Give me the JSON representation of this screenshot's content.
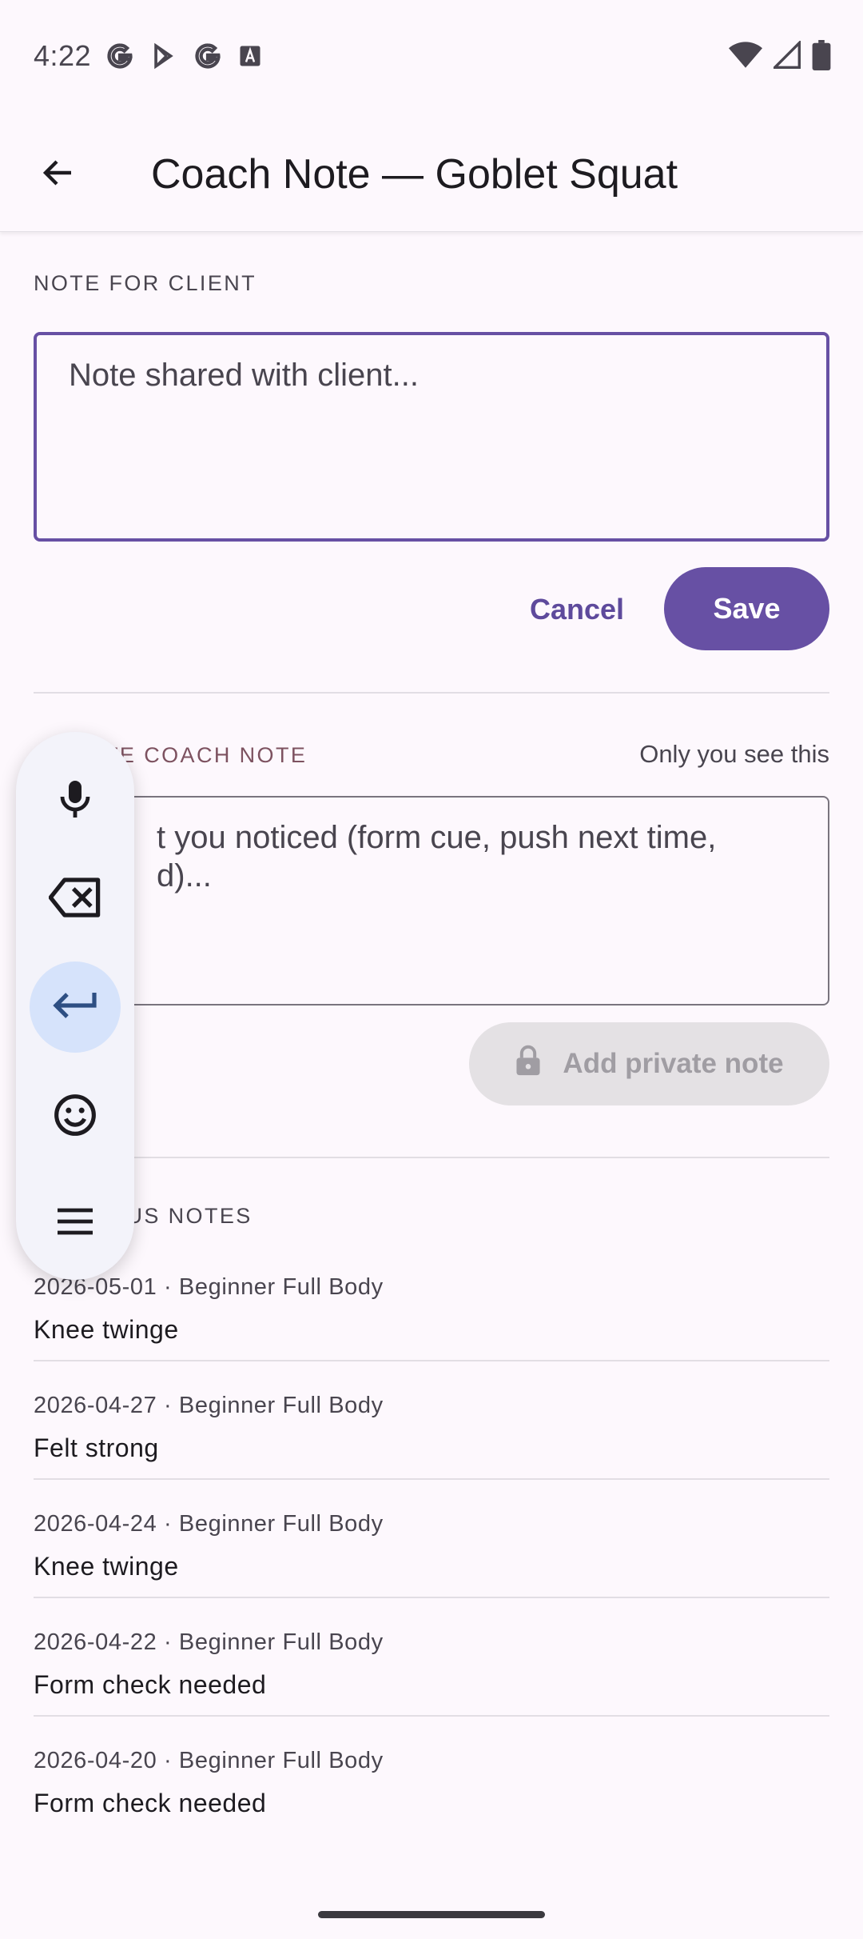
{
  "status_bar": {
    "time": "4:22",
    "left_icons": [
      "google-g-icon",
      "play-store-icon",
      "google-g-icon",
      "font-a-icon"
    ],
    "right_icons": [
      "wifi-icon",
      "cell-signal-icon",
      "battery-icon"
    ]
  },
  "app_bar": {
    "title": "Coach Note — Goblet Squat",
    "back_icon": "arrow-back-icon"
  },
  "client_note": {
    "label": "NOTE FOR CLIENT",
    "placeholder": "Note shared with client...",
    "cancel_label": "Cancel",
    "save_label": "Save"
  },
  "private_note": {
    "label": "PRIVATE COACH NOTE",
    "label_visible": "VATE COACH NOTE",
    "visibility_hint": "Only you see this",
    "placeholder_line1": "t you noticed (form cue, push next time,",
    "placeholder_line2": "d)...",
    "add_label": "Add private note",
    "add_icon": "lock-icon"
  },
  "previous_notes": {
    "label": "US NOTES",
    "items": [
      {
        "meta": "2026-05-01 · Beginner Full Body",
        "text": "Knee twinge"
      },
      {
        "meta": "2026-04-27 · Beginner Full Body",
        "text": "Felt strong"
      },
      {
        "meta": "2026-04-24 · Beginner Full Body",
        "text": "Knee twinge"
      },
      {
        "meta": "2026-04-22 · Beginner Full Body",
        "text": "Form check needed"
      },
      {
        "meta": "2026-04-20 · Beginner Full Body",
        "text": "Form check needed"
      }
    ]
  },
  "floating_keyboard": {
    "buttons": [
      "mic-icon",
      "backspace-icon",
      "enter-icon",
      "emoji-icon",
      "menu-icon"
    ],
    "active": "enter-icon"
  },
  "colors": {
    "primary": "#6750A4",
    "background": "#FDF8FD",
    "private_label": "#7D5260"
  }
}
